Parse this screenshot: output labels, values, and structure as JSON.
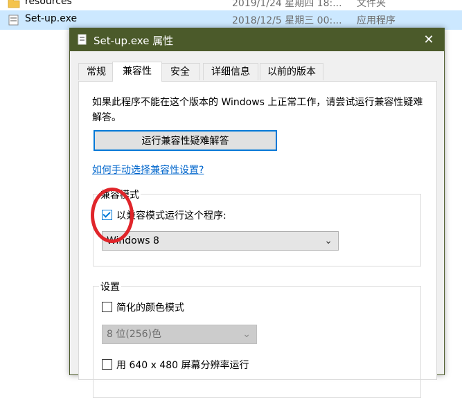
{
  "explorer": {
    "rows": [
      {
        "name": "resources",
        "date": "2019/1/24 星期四 18:...",
        "type": "文件夹"
      },
      {
        "name": "Set-up.exe",
        "date": "2018/12/5 星期三 00:...",
        "type": "应用程序"
      }
    ]
  },
  "dialog": {
    "title": "Set-up.exe 属性",
    "close_glyph": "✕",
    "tabs": [
      "常规",
      "兼容性",
      "安全",
      "详细信息",
      "以前的版本"
    ],
    "active_tab": "兼容性",
    "description": "如果此程序不能在这个版本的 Windows 上正常工作，请尝试运行兼容性疑难解答。",
    "troubleshoot_button": "运行兼容性疑难解答",
    "manual_link": "如何手动选择兼容性设置?",
    "compat_group": {
      "label": "兼容模式",
      "checkbox_label": "以兼容模式运行这个程序:",
      "checked": true,
      "selected_os": "Windows 8"
    },
    "settings_group": {
      "label": "设置",
      "reduced_color_label": "简化的颜色模式",
      "color_select": "8 位(256)色",
      "resolution_label": "用 640 x 480 屏幕分辨率运行"
    }
  },
  "colors": {
    "titlebar": "#4b5a2a",
    "accent": "#0078d7",
    "annotation": "#e0252a",
    "link": "#0066cc"
  },
  "icons": {
    "folder": "folder-icon",
    "exe": "exe-file-icon",
    "close": "close-icon",
    "dropdown": "chevron-down-icon"
  }
}
